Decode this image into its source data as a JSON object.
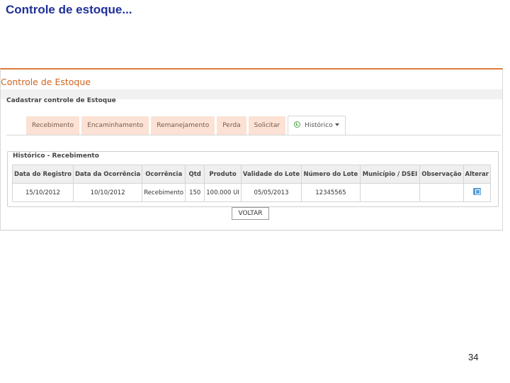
{
  "slide": {
    "title": "Controle de estoque...",
    "page_number": "34"
  },
  "app": {
    "title": "Controle de Estoque",
    "section_title": "Cadastrar controle de Estoque",
    "tabs": [
      {
        "label": "Recebimento",
        "active": false
      },
      {
        "label": "Encaminhamento",
        "active": false
      },
      {
        "label": "Remanejamento",
        "active": false
      },
      {
        "label": "Perda",
        "active": false
      },
      {
        "label": "Solicitar",
        "active": false
      },
      {
        "label": "Histórico",
        "active": true,
        "icon": "history-icon",
        "has_dropdown": true
      }
    ],
    "history_legend": "Histórico - Recebimento",
    "table": {
      "columns": [
        "Data do Registro",
        "Data da Ocorrência",
        "Ocorrência",
        "Qtd",
        "Produto",
        "Validade do Lote",
        "Número do Lote",
        "Município / DSEI",
        "Observação",
        "Alterar"
      ],
      "rows": [
        [
          "15/10/2012",
          "10/10/2012",
          "Recebimento",
          "150",
          "100.000 UI",
          "05/05/2013",
          "12345565",
          "",
          "",
          ""
        ]
      ]
    },
    "back_button": "VOLTAR"
  },
  "colors": {
    "slide_title": "#1f2f9a",
    "accent_orange": "#e07a3a",
    "tab_bg": "#fbe2d4"
  }
}
